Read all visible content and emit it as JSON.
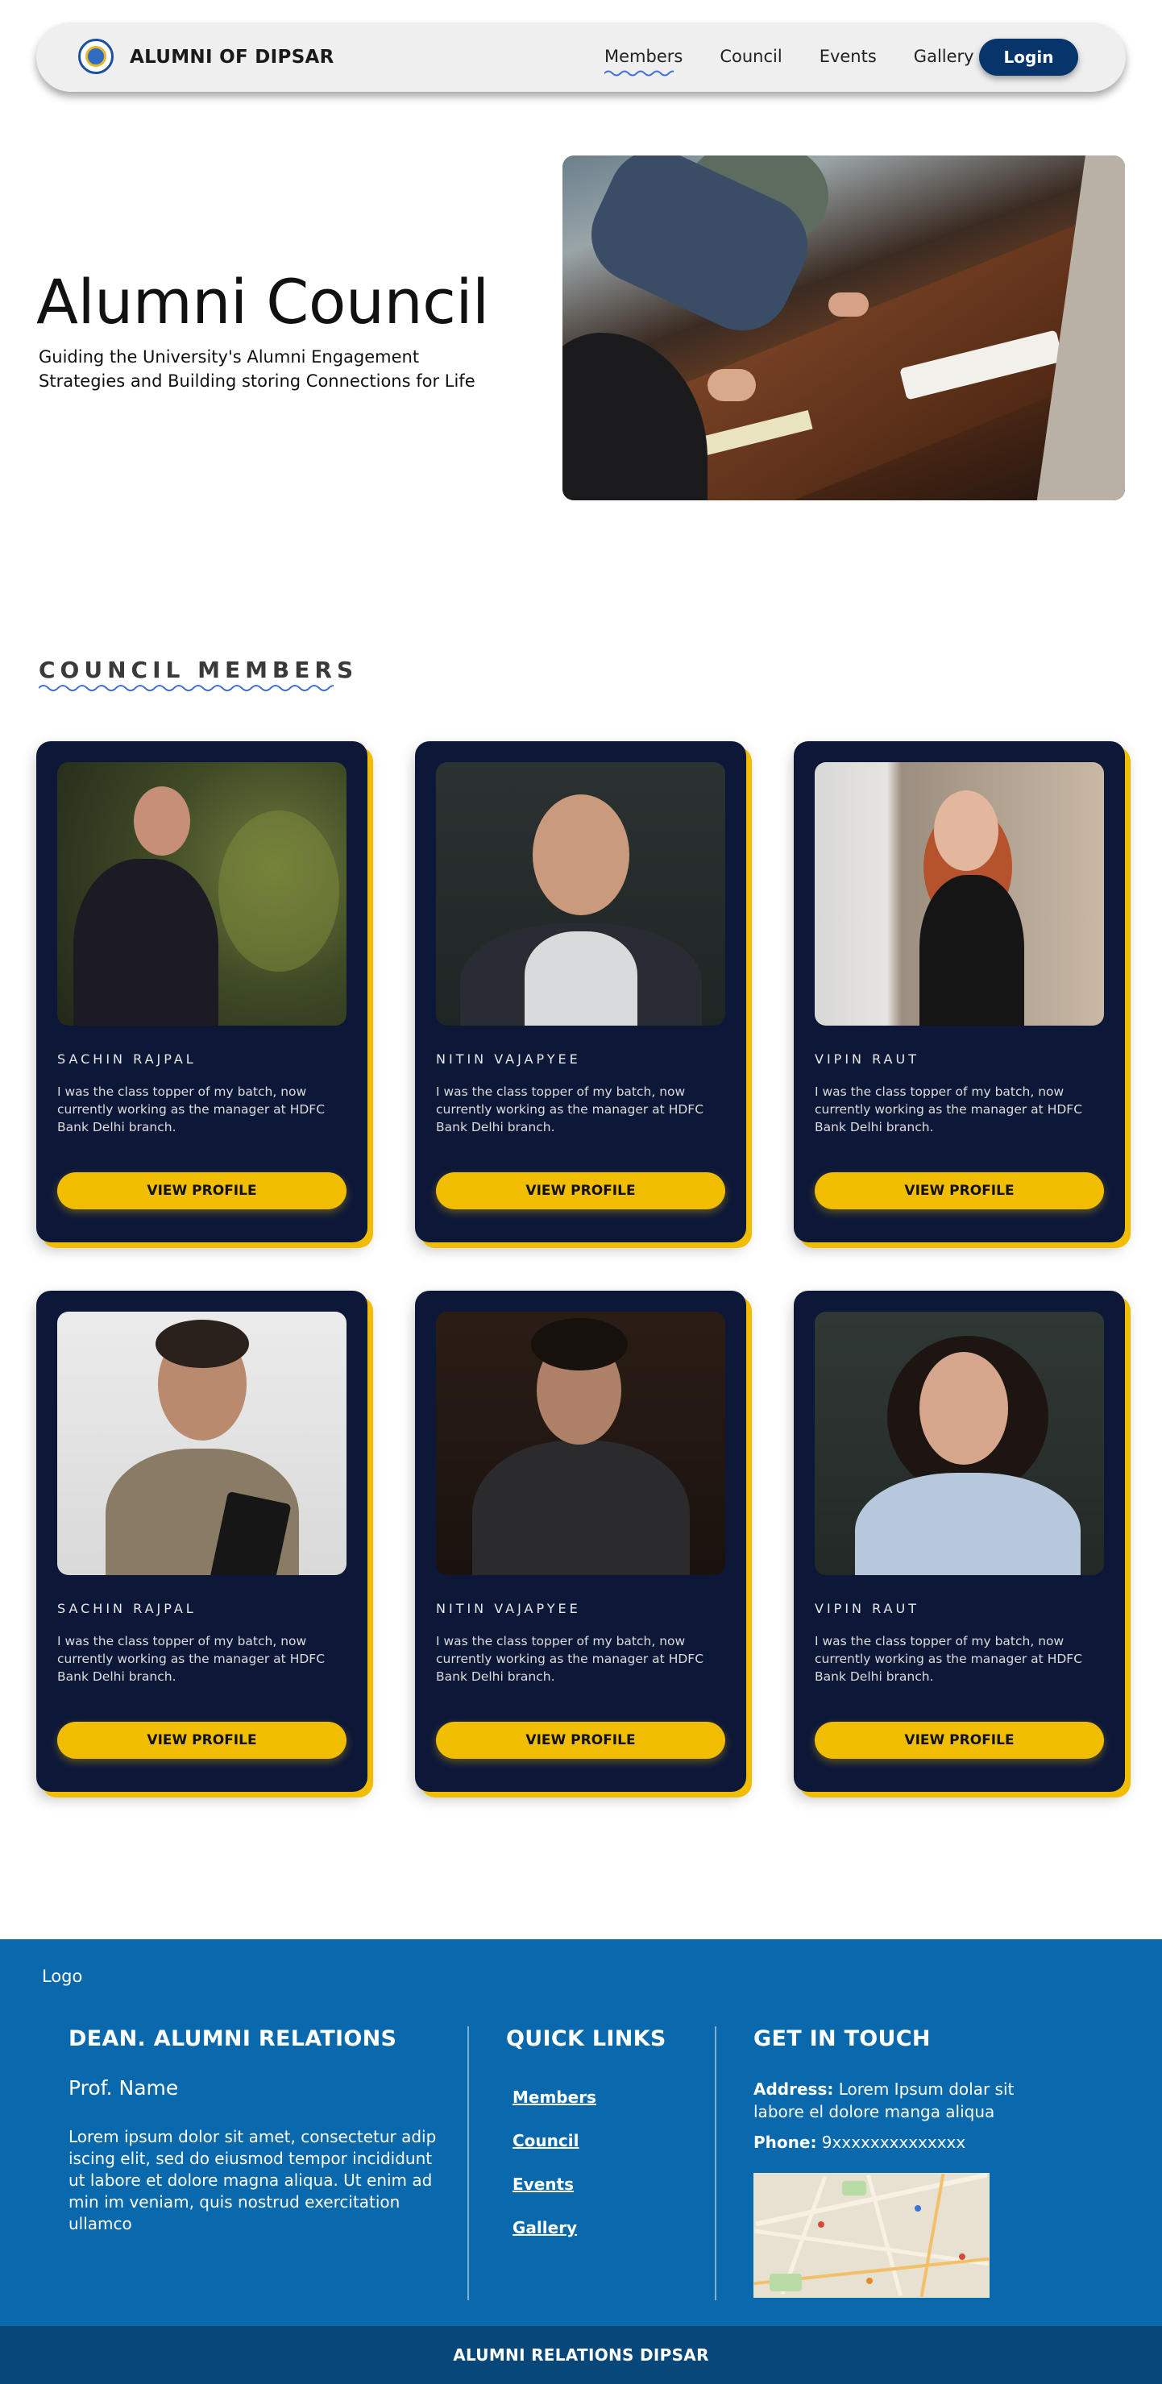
{
  "nav": {
    "brand": "ALUMNI OF DIPSAR",
    "links": [
      "Members",
      "Council",
      "Events",
      "Gallery"
    ],
    "active_link": "Members",
    "login_label": "Login"
  },
  "hero": {
    "title": "Alumni Council",
    "subtitle": "Guiding the University's Alumni Engagement Strategies and Building storing Connections for Life"
  },
  "section": {
    "title": "COUNCIL MEMBERS"
  },
  "members": [
    {
      "name": "SACHIN RAJPAL",
      "bio": "I was the class topper of my batch, now currently working as the manager at HDFC Bank Delhi branch.",
      "button": "VIEW PROFILE"
    },
    {
      "name": "NITIN VAJAPYEE",
      "bio": "I was the class topper of my batch, now currently working as the manager at HDFC Bank Delhi branch.",
      "button": "VIEW PROFILE"
    },
    {
      "name": "VIPIN RAUT",
      "bio": "I was the class topper of my batch, now currently working as the manager at HDFC Bank Delhi branch.",
      "button": "VIEW PROFILE"
    },
    {
      "name": "SACHIN RAJPAL",
      "bio": "I was the class topper of my batch, now currently working as the manager at HDFC Bank Delhi branch.",
      "button": "VIEW PROFILE"
    },
    {
      "name": "NITIN VAJAPYEE",
      "bio": "I was the class topper of my batch, now currently working as the manager at HDFC Bank Delhi branch.",
      "button": "VIEW PROFILE"
    },
    {
      "name": "VIPIN RAUT",
      "bio": "I was the class topper of my batch, now currently working as the manager at HDFC Bank Delhi branch.",
      "button": "VIEW PROFILE"
    }
  ],
  "footer": {
    "logo_text": "Logo",
    "dean_heading": "DEAN. ALUMNI RELATIONS",
    "dean_name": "Prof. Name",
    "dean_text": "Lorem ipsum dolor sit amet, consectetur adip iscing elit, sed do eiusmod tempor incididunt ut labore et dolore magna aliqua. Ut enim ad min im veniam, quis nostrud exercitation ullamco",
    "quick_links_heading": "QUICK LINKS",
    "quick_links": [
      "Members",
      "Council",
      "Events",
      "Gallery"
    ],
    "contact_heading": "GET IN TOUCH",
    "address_label": "Address:",
    "address_value": "Lorem Ipsum dolar sit labore el dolore manga aliqua",
    "phone_label": "Phone:",
    "phone_value": "9xxxxxxxxxxxxxx",
    "bottom_bar": "ALUMNI RELATIONS DIPSAR"
  },
  "colors": {
    "navy_card": "#0d1838",
    "accent_yellow": "#f0bd00",
    "footer_blue": "#0a69ad",
    "bottom_bar_blue": "#07477a",
    "login_button": "#06346b"
  }
}
